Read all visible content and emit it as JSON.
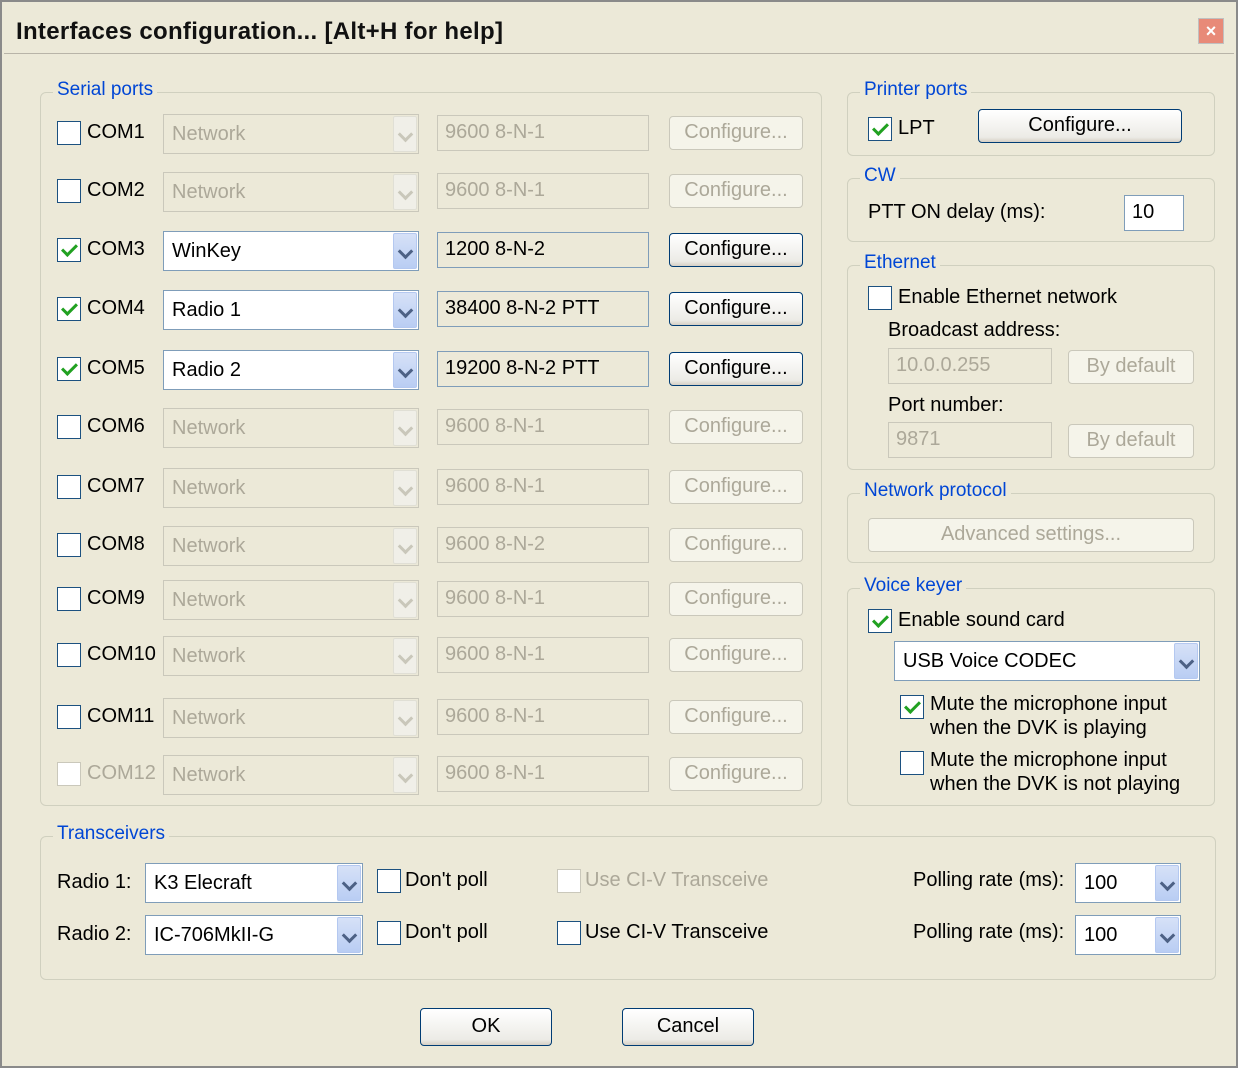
{
  "window": {
    "title": "Interfaces configuration... [Alt+H for help]",
    "close_icon": "×"
  },
  "serial": {
    "title": "Serial ports",
    "rows": [
      {
        "port": "COM1",
        "checked": false,
        "enabled": true,
        "device": "Network",
        "settings": "9600 8-N-1",
        "button": "Configure..."
      },
      {
        "port": "COM2",
        "checked": false,
        "enabled": true,
        "device": "Network",
        "settings": "9600 8-N-1",
        "button": "Configure..."
      },
      {
        "port": "COM3",
        "checked": true,
        "enabled": true,
        "device": "WinKey",
        "settings": "1200 8-N-2",
        "button": "Configure..."
      },
      {
        "port": "COM4",
        "checked": true,
        "enabled": true,
        "device": "Radio 1",
        "settings": "38400 8-N-2 PTT",
        "button": "Configure..."
      },
      {
        "port": "COM5",
        "checked": true,
        "enabled": true,
        "device": "Radio 2",
        "settings": "19200 8-N-2 PTT",
        "button": "Configure..."
      },
      {
        "port": "COM6",
        "checked": false,
        "enabled": true,
        "device": "Network",
        "settings": "9600 8-N-1",
        "button": "Configure..."
      },
      {
        "port": "COM7",
        "checked": false,
        "enabled": true,
        "device": "Network",
        "settings": "9600 8-N-1",
        "button": "Configure..."
      },
      {
        "port": "COM8",
        "checked": false,
        "enabled": true,
        "device": "Network",
        "settings": "9600 8-N-2",
        "button": "Configure..."
      },
      {
        "port": "COM9",
        "checked": false,
        "enabled": true,
        "device": "Network",
        "settings": "9600 8-N-1",
        "button": "Configure..."
      },
      {
        "port": "COM10",
        "checked": false,
        "enabled": true,
        "device": "Network",
        "settings": "9600 8-N-1",
        "button": "Configure..."
      },
      {
        "port": "COM11",
        "checked": false,
        "enabled": true,
        "device": "Network",
        "settings": "9600 8-N-1",
        "button": "Configure..."
      },
      {
        "port": "COM12",
        "checked": false,
        "enabled": false,
        "device": "Network",
        "settings": "9600 8-N-1",
        "button": "Configure..."
      }
    ]
  },
  "printer": {
    "title": "Printer ports",
    "lpt_label": "LPT",
    "lpt_checked": true,
    "configure_label": "Configure..."
  },
  "cw": {
    "title": "CW",
    "ptt_label": "PTT ON delay (ms):",
    "ptt_value": "10"
  },
  "ethernet": {
    "title": "Ethernet",
    "enable_label": "Enable Ethernet network",
    "enable_checked": false,
    "broadcast_label": "Broadcast address:",
    "broadcast_value": "10.0.0.255",
    "port_label": "Port number:",
    "port_value": "9871",
    "default_label": "By default"
  },
  "network": {
    "title": "Network protocol",
    "advanced_label": "Advanced settings..."
  },
  "voice": {
    "title": "Voice keyer",
    "enable_label": "Enable sound card",
    "enable_checked": true,
    "device": "USB Voice CODEC",
    "mute_playing_1": "Mute the microphone input",
    "mute_playing_2": "when the DVK is playing",
    "mute_playing_checked": true,
    "mute_not_playing_1": "Mute the microphone input",
    "mute_not_playing_2": "when the DVK is not playing",
    "mute_not_playing_checked": false
  },
  "transceivers": {
    "title": "Transceivers",
    "rows": [
      {
        "label": "Radio 1:",
        "model": "K3 Elecraft",
        "dont_poll": "Don't poll",
        "civ": "Use CI-V Transceive",
        "civ_enabled": false,
        "polling_label": "Polling rate (ms):",
        "polling": "100"
      },
      {
        "label": "Radio 2:",
        "model": "IC-706MkII-G",
        "dont_poll": "Don't poll",
        "civ": "Use CI-V Transceive",
        "civ_enabled": true,
        "polling_label": "Polling rate (ms):",
        "polling": "100"
      }
    ]
  },
  "buttons": {
    "ok": "OK",
    "cancel": "Cancel"
  },
  "colors": {
    "group_title": "#0046d5",
    "disabled_text": "#aca899",
    "check_mark": "#21a121"
  }
}
